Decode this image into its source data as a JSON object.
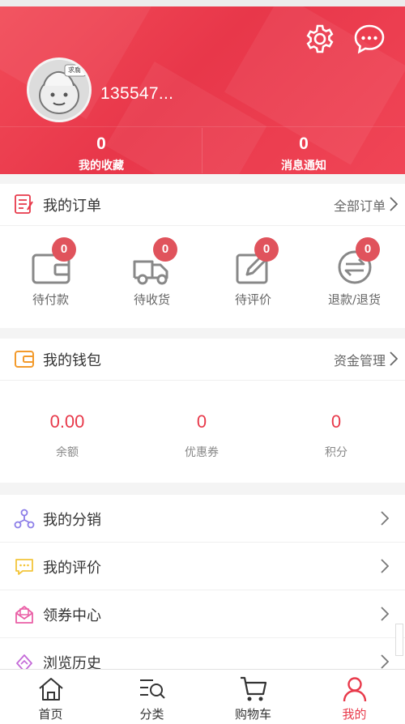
{
  "colors": {
    "brand": "#e8394a",
    "badge": "#e0535c",
    "header_bg": "#ec3f50"
  },
  "header": {
    "username": "135547...",
    "avatar_caption": "求腐",
    "settings_icon": "gear-icon",
    "message_icon": "chat-bubble-icon",
    "stats": [
      {
        "value": "0",
        "label": "我的收藏"
      },
      {
        "value": "0",
        "label": "消息通知"
      }
    ]
  },
  "orders": {
    "title": "我的订单",
    "more": "全部订单",
    "items": [
      {
        "label": "待付款",
        "count": "0",
        "icon": "wallet-icon"
      },
      {
        "label": "待收货",
        "count": "0",
        "icon": "truck-icon"
      },
      {
        "label": "待评价",
        "count": "0",
        "icon": "edit-icon"
      },
      {
        "label": "退款/退货",
        "count": "0",
        "icon": "refund-icon"
      }
    ]
  },
  "wallet": {
    "title": "我的钱包",
    "more": "资金管理",
    "items": [
      {
        "value": "0.00",
        "label": "余额"
      },
      {
        "value": "0",
        "label": "优惠券"
      },
      {
        "value": "0",
        "label": "积分"
      }
    ]
  },
  "menu": [
    {
      "label": "我的分销",
      "icon": "network-icon"
    },
    {
      "label": "我的评价",
      "icon": "comment-icon"
    },
    {
      "label": "领券中心",
      "icon": "coupon-icon"
    },
    {
      "label": "浏览历史",
      "icon": "history-icon"
    }
  ],
  "tabs": [
    {
      "label": "首页",
      "icon": "home-icon"
    },
    {
      "label": "分类",
      "icon": "category-search-icon"
    },
    {
      "label": "购物车",
      "icon": "cart-icon"
    },
    {
      "label": "我的",
      "icon": "user-icon",
      "active": true
    }
  ]
}
